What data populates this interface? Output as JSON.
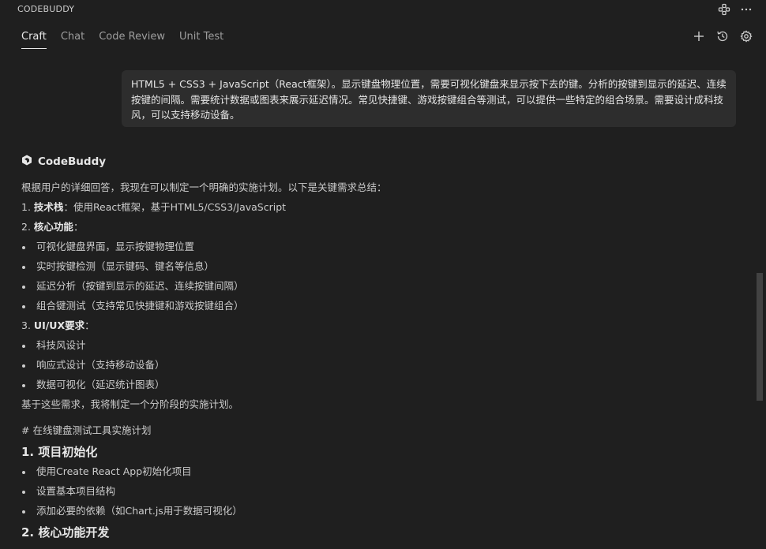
{
  "app": {
    "title": "CODEBUDDY"
  },
  "tabs": [
    {
      "label": "Craft",
      "active": true
    },
    {
      "label": "Chat"
    },
    {
      "label": "Code Review"
    },
    {
      "label": "Unit Test"
    }
  ],
  "icons": {
    "title_actions": [
      "extensions-icon",
      "more-icon"
    ],
    "tab_actions": [
      "add-icon",
      "history-icon",
      "settings-icon"
    ],
    "assistant_logo": "codebuddy-logo-icon"
  },
  "user_message": {
    "text": "HTML5 + CSS3 + JavaScript（React框架）。显示键盘物理位置，需要可视化键盘来显示按下去的键。分析的按键到显示的延迟、连续按键的间隔。需要统计数据或图表来展示延迟情况。常见快捷键、游戏按键组合等测试，可以提供一些特定的组合场景。需要设计成科技风，可以支持移动设备。"
  },
  "assistant": {
    "name": "CodeBuddy",
    "intro": "根据用户的详细回答，我现在可以制定一个明确的实施计划。以下是关键需求总结：",
    "item1_num": "1.",
    "item1_label": "技术栈",
    "item1_text": "：使用React框架，基于HTML5/CSS3/JavaScript",
    "item2_num": "2.",
    "item2_label": "核心功能",
    "item2_colon": "：",
    "item2_bullets": [
      "可视化键盘界面，显示按键物理位置",
      "实时按键检测（显示键码、键名等信息）",
      "延迟分析（按键到显示的延迟、连续按键间隔）",
      "组合键测试（支持常见快捷键和游戏按键组合）"
    ],
    "item3_num": "3.",
    "item3_label": "UI/UX要求",
    "item3_colon": "：",
    "item3_bullets": [
      "科技风设计",
      "响应式设计（支持移动设备）",
      "数据可视化（延迟统计图表）"
    ],
    "summary": "基于这些需求，我将制定一个分阶段的实施计划。",
    "plan_title": "# 在线键盘测试工具实施计划",
    "section1_heading": "1. 项目初始化",
    "section1_bullets": [
      "使用Create React App初始化项目",
      "设置基本项目结构",
      "添加必要的依赖（如Chart.js用于数据可视化）"
    ],
    "section2_heading": "2. 核心功能开发"
  }
}
